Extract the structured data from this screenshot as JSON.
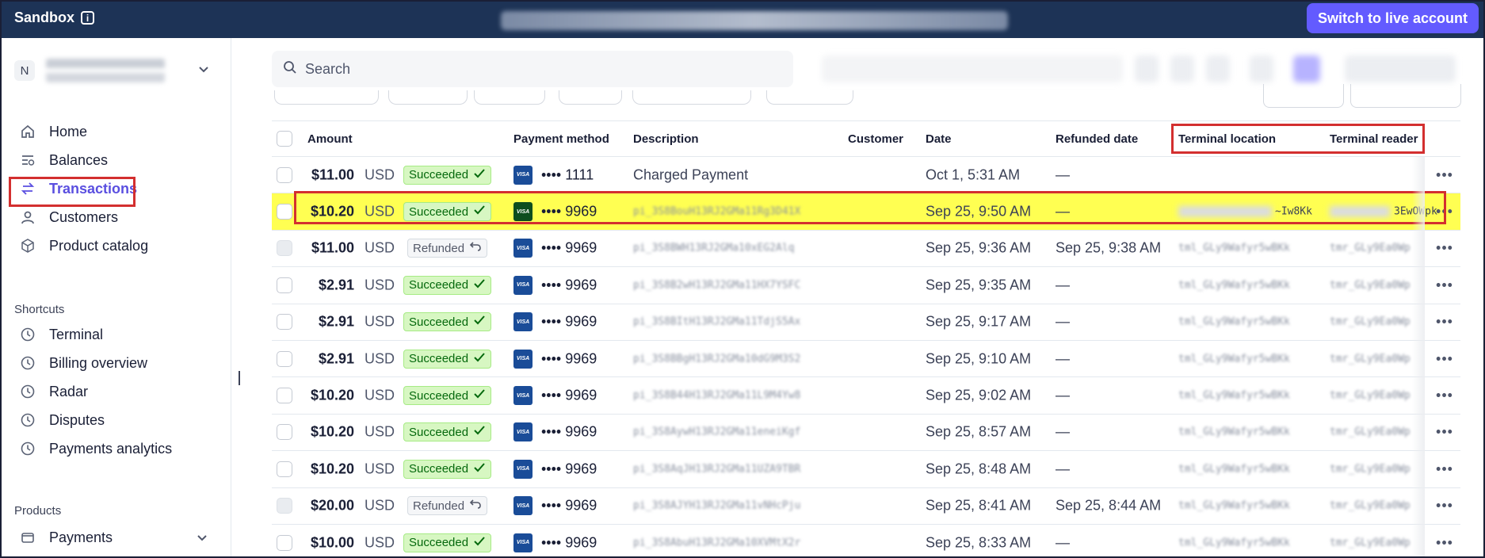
{
  "banner": {
    "env_label": "Sandbox",
    "live_button": "Switch to live account"
  },
  "sidebar": {
    "account_initial": "N",
    "nav": [
      {
        "label": "Home",
        "icon": "home-icon"
      },
      {
        "label": "Balances",
        "icon": "balances-icon"
      },
      {
        "label": "Transactions",
        "icon": "transactions-icon",
        "active": true
      },
      {
        "label": "Customers",
        "icon": "person-icon"
      },
      {
        "label": "Product catalog",
        "icon": "box-icon"
      }
    ],
    "shortcuts_title": "Shortcuts",
    "shortcuts": [
      {
        "label": "Terminal",
        "icon": "clock-icon"
      },
      {
        "label": "Billing overview",
        "icon": "clock-icon"
      },
      {
        "label": "Radar",
        "icon": "clock-icon"
      },
      {
        "label": "Disputes",
        "icon": "clock-icon"
      },
      {
        "label": "Payments analytics",
        "icon": "clock-icon"
      }
    ],
    "products_title": "Products",
    "products": [
      {
        "label": "Payments",
        "icon": "wallet-icon"
      }
    ]
  },
  "search": {
    "placeholder": "Search"
  },
  "table": {
    "headers": {
      "amount": "Amount",
      "payment_method": "Payment method",
      "description": "Description",
      "customer": "Customer",
      "date": "Date",
      "refunded_date": "Refunded date",
      "terminal_location": "Terminal location",
      "terminal_reader": "Terminal reader"
    },
    "rows": [
      {
        "amount": "$11.00",
        "currency": "USD",
        "status": "Succeeded",
        "pm": "•••• 1111",
        "description": "Charged Payment",
        "date": "Oct 1, 5:31 AM",
        "refunded": "—",
        "loc": "",
        "reader": ""
      },
      {
        "amount": "$10.20",
        "currency": "USD",
        "status": "Succeeded",
        "pm": "•••• 9969",
        "description": "pi_3S8BouH13RJ2GMa11Rg3D41X",
        "date": "Sep 25, 9:50 AM",
        "refunded": "—",
        "loc": "~Iw8Kk",
        "reader": "3EwOWpk",
        "highlight": true
      },
      {
        "amount": "$11.00",
        "currency": "USD",
        "status": "Refunded",
        "pm": "•••• 9969",
        "description": "pi_3S8BWH13RJ2GMa10xEG2Alq",
        "date": "Sep 25, 9:36 AM",
        "refunded": "Sep 25, 9:38 AM",
        "loc": "tml_GLy9Wafyr5wBKk",
        "reader": "tmr_GLy9Ea0Wp"
      },
      {
        "amount": "$2.91",
        "currency": "USD",
        "status": "Succeeded",
        "pm": "•••• 9969",
        "description": "pi_3S8B2wH13RJ2GMa11HX7YSFC",
        "date": "Sep 25, 9:35 AM",
        "refunded": "—",
        "loc": "tml_GLy9Wafyr5wBKk",
        "reader": "tmr_GLy9Ea0Wp"
      },
      {
        "amount": "$2.91",
        "currency": "USD",
        "status": "Succeeded",
        "pm": "•••• 9969",
        "description": "pi_3S8BItH13RJ2GMa11TdjS5Ax",
        "date": "Sep 25, 9:17 AM",
        "refunded": "—",
        "loc": "tml_GLy9Wafyr5wBKk",
        "reader": "tmr_GLy9Ea0Wp"
      },
      {
        "amount": "$2.91",
        "currency": "USD",
        "status": "Succeeded",
        "pm": "•••• 9969",
        "description": "pi_3S8BBgH13RJ2GMa10dG9M3S2",
        "date": "Sep 25, 9:10 AM",
        "refunded": "—",
        "loc": "tml_GLy9Wafyr5wBKk",
        "reader": "tmr_GLy9Ea0Wp"
      },
      {
        "amount": "$10.20",
        "currency": "USD",
        "status": "Succeeded",
        "pm": "•••• 9969",
        "description": "pi_3S8B44H13RJ2GMa11L9M4Yw8",
        "date": "Sep 25, 9:02 AM",
        "refunded": "—",
        "loc": "tml_GLy9Wafyr5wBKk",
        "reader": "tmr_GLy9Ea0Wp"
      },
      {
        "amount": "$10.20",
        "currency": "USD",
        "status": "Succeeded",
        "pm": "•••• 9969",
        "description": "pi_3S8AywH13RJ2GMa11eneiKgf",
        "date": "Sep 25, 8:57 AM",
        "refunded": "—",
        "loc": "tml_GLy9Wafyr5wBKk",
        "reader": "tmr_GLy9Ea0Wp"
      },
      {
        "amount": "$10.20",
        "currency": "USD",
        "status": "Succeeded",
        "pm": "•••• 9969",
        "description": "pi_3S8AqJH13RJ2GMa11UZA9TBR",
        "date": "Sep 25, 8:48 AM",
        "refunded": "—",
        "loc": "tml_GLy9Wafyr5wBKk",
        "reader": "tmr_GLy9Ea0Wp"
      },
      {
        "amount": "$20.00",
        "currency": "USD",
        "status": "Refunded",
        "pm": "•••• 9969",
        "description": "pi_3S8AJYH13RJ2GMa11vNHcPju",
        "date": "Sep 25, 8:41 AM",
        "refunded": "Sep 25, 8:44 AM",
        "loc": "tml_GLy9Wafyr5wBKk",
        "reader": "tmr_GLy9Ea0Wp"
      },
      {
        "amount": "$10.00",
        "currency": "USD",
        "status": "Succeeded",
        "pm": "•••• 9969",
        "description": "pi_3S8AbuH13RJ2GMa10XVMtX2r",
        "date": "Sep 25, 8:33 AM",
        "refunded": "—",
        "loc": "tml_GLy9Wafyr5wBKk",
        "reader": "tmr_GLy9Ea0Wp"
      }
    ]
  },
  "colors": {
    "banner": "#1d3356",
    "accent": "#635bff",
    "highlight": "#ffff52",
    "annotation": "#d32f2f"
  }
}
